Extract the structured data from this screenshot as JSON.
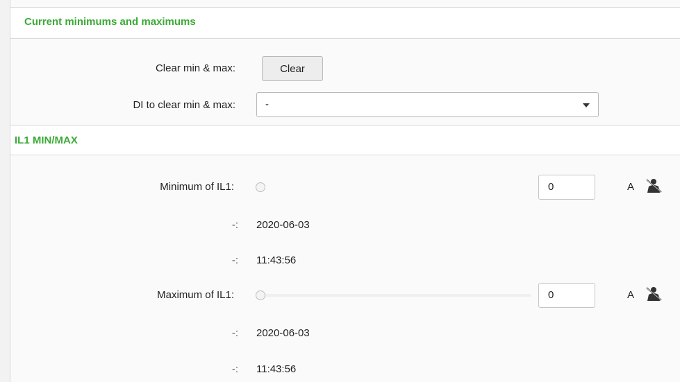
{
  "sections": {
    "current_minmax_title": "Current minimums and maximums",
    "il1_title": "IL1 MIN/MAX"
  },
  "clear": {
    "label": "Clear min & max:",
    "button_label": "Clear"
  },
  "di_clear": {
    "label": "DI to clear min & max:",
    "selected": "-"
  },
  "il1": {
    "minimum": {
      "label": "Minimum of IL1:",
      "value": "0",
      "unit": "A",
      "date_label": "-:",
      "date": "2020-06-03",
      "time_label": "-:",
      "time": "11:43:56"
    },
    "maximum": {
      "label": "Maximum of IL1:",
      "value": "0",
      "unit": "A",
      "date_label": "-:",
      "date": "2020-06-03",
      "time_label": "-:",
      "time": "11:43:56"
    }
  },
  "colors": {
    "section_title": "#3aaa35",
    "background": "#fafafa"
  },
  "icons": {
    "manual_override": "person-struck-icon"
  }
}
